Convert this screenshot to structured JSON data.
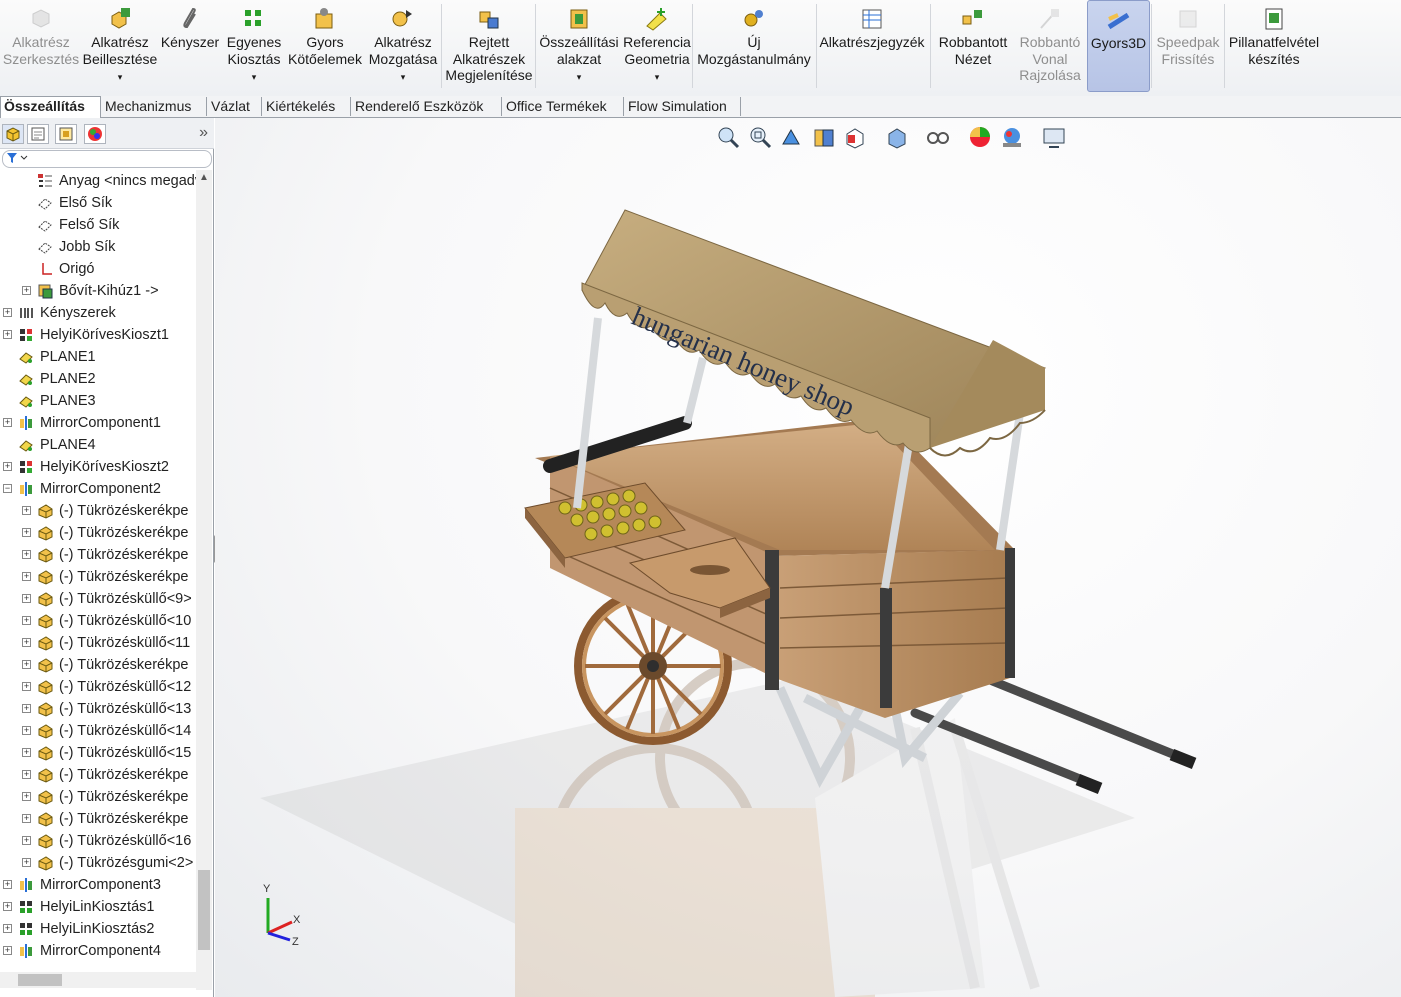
{
  "ribbon": {
    "buttons": [
      {
        "label": "Alkatrész\nSzerkesztés",
        "icon": "edit-component-icon",
        "disabled": true
      },
      {
        "label": "Alkatrész\nBeillesztése",
        "icon": "insert-component-icon",
        "dropdown": true
      },
      {
        "label": "Kényszer",
        "icon": "mate-paperclip-icon"
      },
      {
        "label": "Egyenes\nKiosztás",
        "icon": "linear-pattern-icon",
        "dropdown": true
      },
      {
        "label": "Gyors\nKötőelemek",
        "icon": "smart-fasteners-icon"
      },
      {
        "label": "Alkatrész\nMozgatása",
        "icon": "move-component-icon",
        "dropdown": true
      },
      {
        "label": "Rejtett\nAlkatrészek\nMegjelenítése",
        "icon": "show-hidden-components-icon"
      },
      {
        "label": "Összeállítási\nalakzat",
        "icon": "assembly-feature-icon",
        "dropdown": true
      },
      {
        "label": "Referencia\nGeometria",
        "icon": "reference-geometry-icon",
        "dropdown": true
      },
      {
        "label": "Új\nMozgástanulmány",
        "icon": "motion-study-icon"
      },
      {
        "label": "Alkatrészjegyzék",
        "icon": "bill-of-materials-icon"
      },
      {
        "label": "Robbantott\nNézet",
        "icon": "exploded-view-icon"
      },
      {
        "label": "Robbantó\nVonal\nRajzolása",
        "icon": "explode-line-sketch-icon",
        "disabled": true
      },
      {
        "label": "Gyors3D",
        "icon": "instant3d-icon",
        "active": true
      },
      {
        "label": "Speedpak\nFrissítés",
        "icon": "speedpak-icon",
        "disabled": true
      },
      {
        "label": "Pillanatfelvétel\nkészítés",
        "icon": "snapshot-icon"
      }
    ]
  },
  "tabs": [
    "Összeállítás",
    "Mechanizmus",
    "Vázlat",
    "Kiértékelés",
    "Renderelő Eszközök",
    "Office Termékek",
    "Flow Simulation"
  ],
  "active_tab": "Összeállítás",
  "panel": {
    "tabs": [
      "feature-manager-icon",
      "property-manager-icon",
      "configuration-manager-icon",
      "appearance-manager-icon"
    ],
    "expand_symbol": "»",
    "tree": [
      {
        "label": "Anyag <nincs megadva>",
        "icon": "material-icon",
        "indent": 1,
        "expander": "none"
      },
      {
        "label": "Első Sík",
        "icon": "plane-icon",
        "indent": 1,
        "expander": "none"
      },
      {
        "label": "Felső Sík",
        "icon": "plane-icon",
        "indent": 1,
        "expander": "none"
      },
      {
        "label": "Jobb Sík",
        "icon": "plane-icon",
        "indent": 1,
        "expander": "none"
      },
      {
        "label": "Origó",
        "icon": "origin-icon",
        "indent": 1,
        "expander": "none"
      },
      {
        "label": "Bővít-Kihúz1 ->",
        "icon": "extrude-feature-icon",
        "indent": 1,
        "expander": "plus"
      },
      {
        "label": "Kényszerek",
        "icon": "mates-icon",
        "indent": 0,
        "expander": "plus"
      },
      {
        "label": "HelyiKörívesKioszt1",
        "icon": "circular-pattern-icon",
        "indent": 0,
        "expander": "plus"
      },
      {
        "label": "PLANE1",
        "icon": "plane-yellow-icon",
        "indent": 0,
        "expander": "none"
      },
      {
        "label": "PLANE2",
        "icon": "plane-yellow-icon",
        "indent": 0,
        "expander": "none"
      },
      {
        "label": "PLANE3",
        "icon": "plane-yellow-icon",
        "indent": 0,
        "expander": "none"
      },
      {
        "label": "MirrorComponent1",
        "icon": "mirror-component-icon",
        "indent": 0,
        "expander": "plus"
      },
      {
        "label": "PLANE4",
        "icon": "plane-yellow-icon",
        "indent": 0,
        "expander": "none"
      },
      {
        "label": "HelyiKörívesKioszt2",
        "icon": "circular-pattern-icon",
        "indent": 0,
        "expander": "plus"
      },
      {
        "label": "MirrorComponent2",
        "icon": "mirror-component-icon",
        "indent": 0,
        "expander": "minus"
      },
      {
        "label": "(-) Tükrözéskerékpe",
        "icon": "part-icon",
        "indent": 1,
        "expander": "plus"
      },
      {
        "label": "(-) Tükrözéskerékpe",
        "icon": "part-icon",
        "indent": 1,
        "expander": "plus"
      },
      {
        "label": "(-) Tükrözéskerékpe",
        "icon": "part-icon",
        "indent": 1,
        "expander": "plus"
      },
      {
        "label": "(-) Tükrözéskerékpe",
        "icon": "part-icon",
        "indent": 1,
        "expander": "plus"
      },
      {
        "label": "(-) Tükrözésküllő<9>",
        "icon": "part-icon",
        "indent": 1,
        "expander": "plus"
      },
      {
        "label": "(-) Tükrözésküllő<10",
        "icon": "part-icon",
        "indent": 1,
        "expander": "plus"
      },
      {
        "label": "(-) Tükrözésküllő<11",
        "icon": "part-icon",
        "indent": 1,
        "expander": "plus"
      },
      {
        "label": "(-) Tükrözéskerékpe",
        "icon": "part-icon",
        "indent": 1,
        "expander": "plus"
      },
      {
        "label": "(-) Tükrözésküllő<12",
        "icon": "part-icon",
        "indent": 1,
        "expander": "plus"
      },
      {
        "label": "(-) Tükrözésküllő<13",
        "icon": "part-icon",
        "indent": 1,
        "expander": "plus"
      },
      {
        "label": "(-) Tükrözésküllő<14",
        "icon": "part-icon",
        "indent": 1,
        "expander": "plus"
      },
      {
        "label": "(-) Tükrözésküllő<15",
        "icon": "part-icon",
        "indent": 1,
        "expander": "plus"
      },
      {
        "label": "(-) Tükrözéskerékpe",
        "icon": "part-icon",
        "indent": 1,
        "expander": "plus"
      },
      {
        "label": "(-) Tükrözéskerékpe",
        "icon": "part-icon",
        "indent": 1,
        "expander": "plus"
      },
      {
        "label": "(-) Tükrözéskerékpe",
        "icon": "part-icon",
        "indent": 1,
        "expander": "plus"
      },
      {
        "label": "(-) Tükrözésküllő<16",
        "icon": "part-icon",
        "indent": 1,
        "expander": "plus"
      },
      {
        "label": "(-) Tükrözésgumi<2>",
        "icon": "part-icon",
        "indent": 1,
        "expander": "plus"
      },
      {
        "label": "MirrorComponent3",
        "icon": "mirror-component-icon",
        "indent": 0,
        "expander": "plus"
      },
      {
        "label": "HelyiLinKiosztás1",
        "icon": "linear-pattern-icon",
        "indent": 0,
        "expander": "plus"
      },
      {
        "label": "HelyiLinKiosztás2",
        "icon": "linear-pattern-icon",
        "indent": 0,
        "expander": "plus"
      },
      {
        "label": "MirrorComponent4",
        "icon": "mirror-component-icon",
        "indent": 0,
        "expander": "plus"
      }
    ]
  },
  "viewport": {
    "hud_icons": [
      "zoom-to-fit-icon",
      "zoom-to-area-icon",
      "previous-view-icon",
      "section-view-icon",
      "view-orientation-icon",
      "display-style-icon",
      "hide-show-items-icon",
      "edit-appearance-icon",
      "apply-scene-icon",
      "view-settings-icon"
    ],
    "sign_text": "hungarian honey shop",
    "triad_labels": {
      "x": "X",
      "y": "Y",
      "z": "Z"
    }
  },
  "colors": {
    "wood_light": "#c8a47c",
    "wood_dark": "#a57c52",
    "roof": "#b49a6c",
    "metal": "#d9dcdf",
    "sign_text": "#24304a",
    "active_button": "#b7c4e6"
  }
}
